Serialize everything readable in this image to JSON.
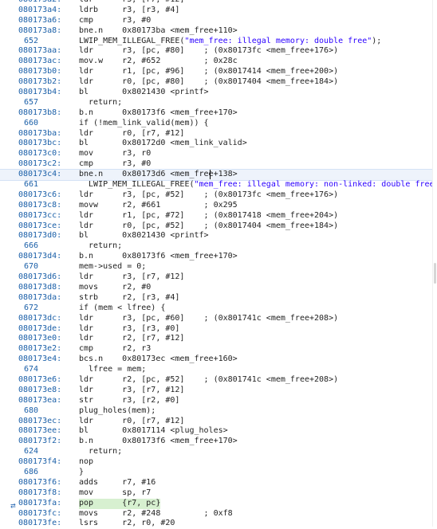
{
  "lines": [
    {
      "type": "asm",
      "addr": "080173a2:",
      "text": "ldr      r3, [r7, #12]"
    },
    {
      "type": "asm",
      "addr": "080173a4:",
      "text": "ldrb     r3, [r3, #4]"
    },
    {
      "type": "asm",
      "addr": "080173a6:",
      "text": "cmp      r3, #0"
    },
    {
      "type": "asm",
      "addr": "080173a8:",
      "text": "bne.n    0x80173ba <mem_free+110>"
    },
    {
      "type": "src",
      "num": "652",
      "text": "LWIP_MEM_ILLEGAL_FREE(\"mem_free: illegal memory: double free\");"
    },
    {
      "type": "asm",
      "addr": "080173aa:",
      "text": "ldr      r3, [pc, #80]    ; (0x80173fc <mem_free+176>)"
    },
    {
      "type": "asm",
      "addr": "080173ac:",
      "text": "mov.w    r2, #652         ; 0x28c"
    },
    {
      "type": "asm",
      "addr": "080173b0:",
      "text": "ldr      r1, [pc, #96]    ; (0x8017414 <mem_free+200>)"
    },
    {
      "type": "asm",
      "addr": "080173b2:",
      "text": "ldr      r0, [pc, #80]    ; (0x8017404 <mem_free+184>)"
    },
    {
      "type": "asm",
      "addr": "080173b4:",
      "text": "bl       0x8021430 <printf>"
    },
    {
      "type": "src",
      "num": "657",
      "text": "  return;"
    },
    {
      "type": "asm",
      "addr": "080173b8:",
      "text": "b.n      0x80173f6 <mem_free+170>"
    },
    {
      "type": "src",
      "num": "660",
      "text": "if (!mem_link_valid(mem)) {"
    },
    {
      "type": "asm",
      "addr": "080173ba:",
      "text": "ldr      r0, [r7, #12]"
    },
    {
      "type": "asm",
      "addr": "080173bc:",
      "text": "bl       0x80172d0 <mem_link_valid>"
    },
    {
      "type": "asm",
      "addr": "080173c0:",
      "text": "mov      r3, r0"
    },
    {
      "type": "asm",
      "addr": "080173c2:",
      "text": "cmp      r3, #0"
    },
    {
      "type": "asm",
      "addr": "080173c4:",
      "text": "bne.n    0x80173d6 <mem_free+138>",
      "current": true
    },
    {
      "type": "src",
      "num": "661",
      "text": "  LWIP_MEM_ILLEGAL_FREE(\"mem_free: illegal memory: non-linked: double free"
    },
    {
      "type": "asm",
      "addr": "080173c6:",
      "text": "ldr      r3, [pc, #52]    ; (0x80173fc <mem_free+176>)"
    },
    {
      "type": "asm",
      "addr": "080173c8:",
      "text": "movw     r2, #661         ; 0x295"
    },
    {
      "type": "asm",
      "addr": "080173cc:",
      "text": "ldr      r1, [pc, #72]    ; (0x8017418 <mem_free+204>)"
    },
    {
      "type": "asm",
      "addr": "080173ce:",
      "text": "ldr      r0, [pc, #52]    ; (0x8017404 <mem_free+184>)"
    },
    {
      "type": "asm",
      "addr": "080173d0:",
      "text": "bl       0x8021430 <printf>"
    },
    {
      "type": "src",
      "num": "666",
      "text": "  return;"
    },
    {
      "type": "asm",
      "addr": "080173d4:",
      "text": "b.n      0x80173f6 <mem_free+170>"
    },
    {
      "type": "src",
      "num": "670",
      "text": "mem->used = 0;"
    },
    {
      "type": "asm",
      "addr": "080173d6:",
      "text": "ldr      r3, [r7, #12]"
    },
    {
      "type": "asm",
      "addr": "080173d8:",
      "text": "movs     r2, #0"
    },
    {
      "type": "asm",
      "addr": "080173da:",
      "text": "strb     r2, [r3, #4]"
    },
    {
      "type": "src",
      "num": "672",
      "text": "if (mem < lfree) {"
    },
    {
      "type": "asm",
      "addr": "080173dc:",
      "text": "ldr      r3, [pc, #60]    ; (0x801741c <mem_free+208>)"
    },
    {
      "type": "asm",
      "addr": "080173de:",
      "text": "ldr      r3, [r3, #0]"
    },
    {
      "type": "asm",
      "addr": "080173e0:",
      "text": "ldr      r2, [r7, #12]"
    },
    {
      "type": "asm",
      "addr": "080173e2:",
      "text": "cmp      r2, r3"
    },
    {
      "type": "asm",
      "addr": "080173e4:",
      "text": "bcs.n    0x80173ec <mem_free+160>"
    },
    {
      "type": "src",
      "num": "674",
      "text": "  lfree = mem;"
    },
    {
      "type": "asm",
      "addr": "080173e6:",
      "text": "ldr      r2, [pc, #52]    ; (0x801741c <mem_free+208>)"
    },
    {
      "type": "asm",
      "addr": "080173e8:",
      "text": "ldr      r3, [r7, #12]"
    },
    {
      "type": "asm",
      "addr": "080173ea:",
      "text": "str      r3, [r2, #0]"
    },
    {
      "type": "src",
      "num": "680",
      "text": "plug_holes(mem);"
    },
    {
      "type": "asm",
      "addr": "080173ec:",
      "text": "ldr      r0, [r7, #12]"
    },
    {
      "type": "asm",
      "addr": "080173ee:",
      "text": "bl       0x8017114 <plug_holes>"
    },
    {
      "type": "asm",
      "addr": "080173f2:",
      "text": "b.n      0x80173f6 <mem_free+170>"
    },
    {
      "type": "src",
      "num": "624",
      "text": "  return;"
    },
    {
      "type": "asm",
      "addr": "080173f4:",
      "text": "nop"
    },
    {
      "type": "src",
      "num": "686",
      "text": "}"
    },
    {
      "type": "asm",
      "addr": "080173f6:",
      "text": "adds     r7, #16"
    },
    {
      "type": "asm",
      "addr": "080173f8:",
      "text": "mov      sp, r7"
    },
    {
      "type": "asm",
      "addr": "080173fa:",
      "text": "pop      {r7, pc}",
      "pc": true
    },
    {
      "type": "asm",
      "addr": "080173fc:",
      "text": "movs     r2, #248         ; 0xf8"
    },
    {
      "type": "asm",
      "addr": "080173fe:",
      "text": "lsrs     r2, r0, #20"
    }
  ],
  "gutter_marker_icon": "instruction-pointer-icon"
}
